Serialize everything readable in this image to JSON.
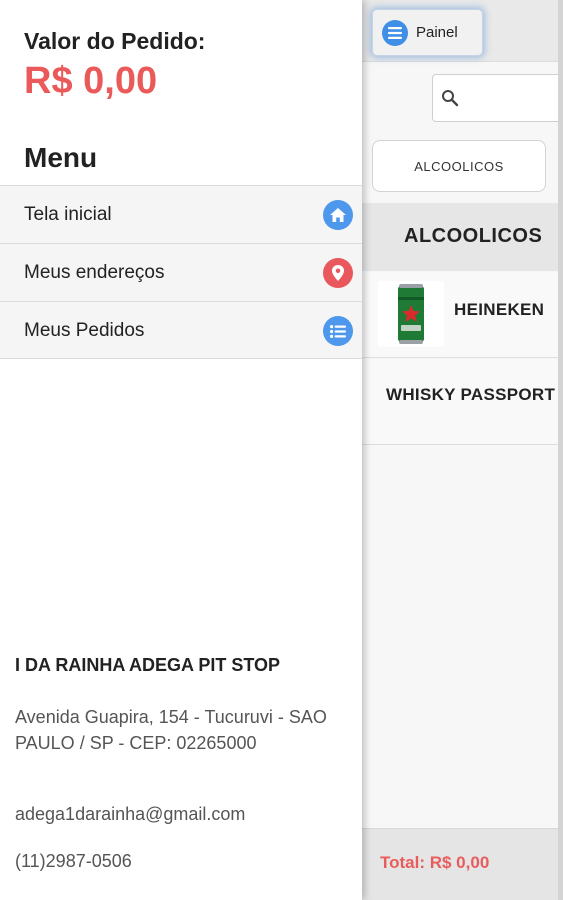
{
  "drawer": {
    "order_label": "Valor do Pedido:",
    "order_value": "R$ 0,00",
    "menu_title": "Menu",
    "menu_items": [
      {
        "label": "Tela inicial",
        "icon": "home-icon",
        "color": "#4d97ec"
      },
      {
        "label": "Meus endereços",
        "icon": "map-pin-icon",
        "color": "#e9585c"
      },
      {
        "label": "Meus Pedidos",
        "icon": "list-icon",
        "color": "#4d97ec"
      }
    ],
    "store": {
      "name": "I DA RAINHA ADEGA PIT STOP",
      "address": "Avenida Guapira, 154 - Tucuruvi - SAO PAULO / SP - CEP: 02265000",
      "email": "adega1darainha@gmail.com",
      "phone": "(11)2987-0506"
    }
  },
  "panel_button": {
    "label": "Painel",
    "icon": "menu-list-icon"
  },
  "main": {
    "search": {
      "placeholder": "",
      "icon": "search-icon"
    },
    "category_button": "ALCOOLICOS",
    "category_header": "ALCOOLICOS",
    "products": [
      {
        "name": "HEINEKEN",
        "image": "beer-can-icon"
      },
      {
        "name": "WHISKY PASSPORT"
      }
    ],
    "total": "Total: R$ 0,00"
  },
  "colors": {
    "accent_red": "#ea5a5a",
    "accent_blue": "#4d97ec"
  }
}
